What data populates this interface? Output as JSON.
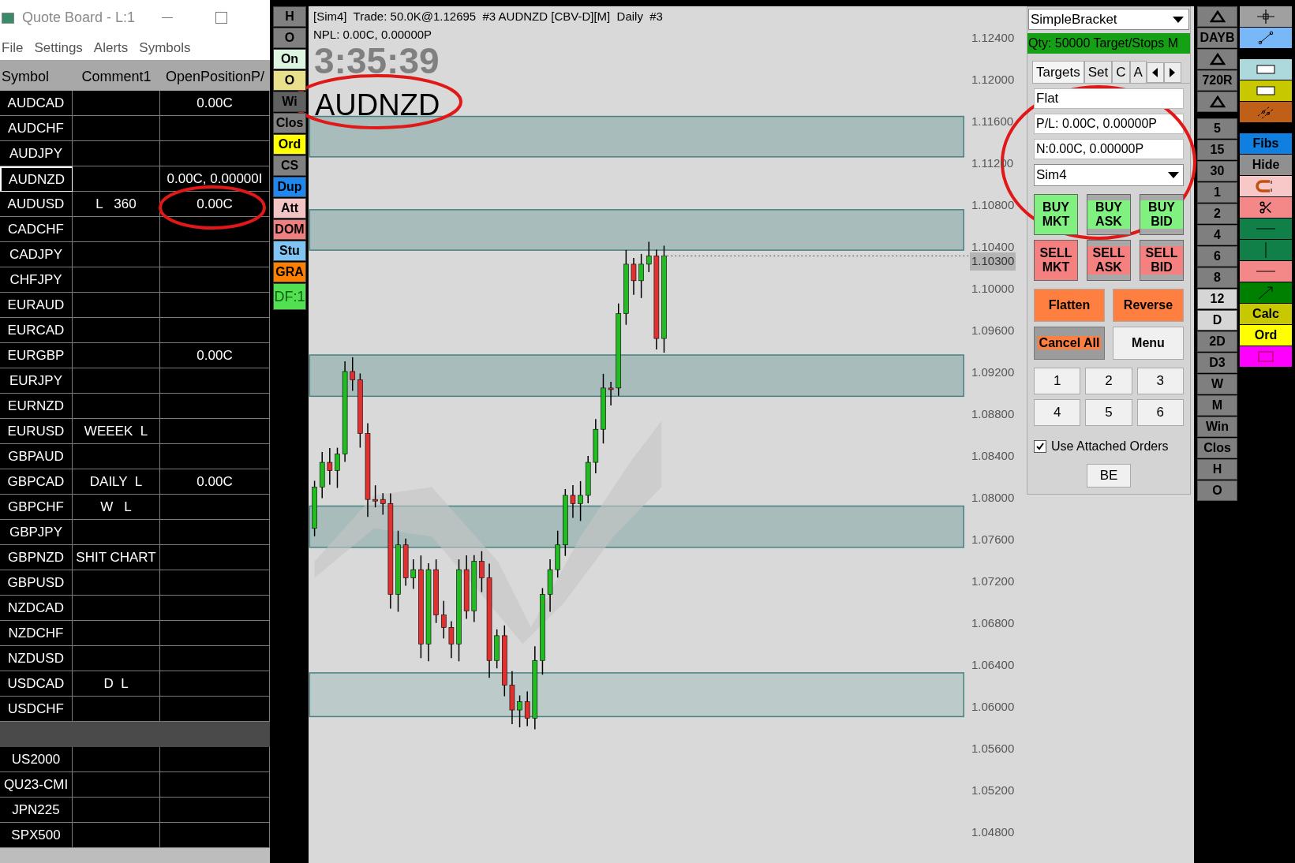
{
  "quote_board": {
    "title": "Quote Board - L:1",
    "menu": [
      "File",
      "Settings",
      "Alerts",
      "Symbols"
    ],
    "columns": [
      "Symbol",
      "Comment1",
      "OpenPositionP/"
    ],
    "rows": [
      {
        "kind": "row",
        "cells": [
          "AUDCAD",
          "",
          "0.00C"
        ],
        "selected": false
      },
      {
        "kind": "row",
        "cells": [
          "AUDCHF",
          "",
          ""
        ],
        "selected": false
      },
      {
        "kind": "row",
        "cells": [
          "AUDJPY",
          "",
          ""
        ],
        "selected": false
      },
      {
        "kind": "row",
        "cells": [
          "AUDNZD",
          "",
          "0.00C, 0.00000I"
        ],
        "selected": true
      },
      {
        "kind": "row",
        "cells": [
          "AUDUSD",
          "L   360",
          "0.00C"
        ],
        "selected": false
      },
      {
        "kind": "row",
        "cells": [
          "CADCHF",
          "",
          ""
        ],
        "selected": false
      },
      {
        "kind": "row",
        "cells": [
          "CADJPY",
          "",
          ""
        ],
        "selected": false
      },
      {
        "kind": "row",
        "cells": [
          "CHFJPY",
          "",
          ""
        ],
        "selected": false
      },
      {
        "kind": "row",
        "cells": [
          "EURAUD",
          "",
          ""
        ],
        "selected": false
      },
      {
        "kind": "row",
        "cells": [
          "EURCAD",
          "",
          ""
        ],
        "selected": false
      },
      {
        "kind": "row",
        "cells": [
          "EURGBP",
          "",
          "0.00C"
        ],
        "selected": false
      },
      {
        "kind": "row",
        "cells": [
          "EURJPY",
          "",
          ""
        ],
        "selected": false
      },
      {
        "kind": "row",
        "cells": [
          "EURNZD",
          "",
          ""
        ],
        "selected": false
      },
      {
        "kind": "row",
        "cells": [
          "EURUSD",
          "WEEEK  L",
          ""
        ],
        "selected": false
      },
      {
        "kind": "row",
        "cells": [
          "GBPAUD",
          "",
          ""
        ],
        "selected": false
      },
      {
        "kind": "row",
        "cells": [
          "GBPCAD",
          "DAILY  L",
          "0.00C"
        ],
        "selected": false
      },
      {
        "kind": "row",
        "cells": [
          "GBPCHF",
          "W   L",
          ""
        ],
        "selected": false
      },
      {
        "kind": "row",
        "cells": [
          "GBPJPY",
          "",
          ""
        ],
        "selected": false
      },
      {
        "kind": "row",
        "cells": [
          "GBPNZD",
          "SHIT CHART",
          ""
        ],
        "selected": false
      },
      {
        "kind": "row",
        "cells": [
          "GBPUSD",
          "",
          ""
        ],
        "selected": false
      },
      {
        "kind": "row",
        "cells": [
          "NZDCAD",
          "",
          ""
        ],
        "selected": false
      },
      {
        "kind": "row",
        "cells": [
          "NZDCHF",
          "",
          ""
        ],
        "selected": false
      },
      {
        "kind": "row",
        "cells": [
          "NZDUSD",
          "",
          ""
        ],
        "selected": false
      },
      {
        "kind": "row",
        "cells": [
          "USDCAD",
          "D  L",
          ""
        ],
        "selected": false
      },
      {
        "kind": "row",
        "cells": [
          "USDCHF",
          "",
          ""
        ],
        "selected": false
      },
      {
        "kind": "separator"
      },
      {
        "kind": "row",
        "cells": [
          "US2000",
          "",
          ""
        ],
        "selected": false
      },
      {
        "kind": "row",
        "cells": [
          "QU23-CMI",
          "",
          ""
        ],
        "selected": false
      },
      {
        "kind": "row",
        "cells": [
          "JPN225",
          "",
          ""
        ],
        "selected": false
      },
      {
        "kind": "row",
        "cells": [
          "SPX500",
          "",
          ""
        ],
        "selected": false
      }
    ]
  },
  "left_buttons": [
    {
      "label": "H",
      "color": "#808080"
    },
    {
      "label": "O",
      "color": "#808080"
    },
    {
      "label": "On",
      "color": "#dcf5e0"
    },
    {
      "label": "O",
      "color": "#e8e08a"
    },
    {
      "label": "Wi",
      "color": "#606060"
    },
    {
      "label": "Clos",
      "color": "#808080"
    },
    {
      "label": "Ord",
      "color": "#ffff00"
    },
    {
      "label": "CS",
      "color": "#808080"
    },
    {
      "label": "Dup",
      "color": "#1e88f0"
    },
    {
      "label": "Att",
      "color": "#f2c4c4"
    },
    {
      "label": "DOM",
      "color": "#f08080"
    },
    {
      "label": "Stu",
      "color": "#80c4f4"
    },
    {
      "label": "GRA",
      "color": "#ff7f00"
    },
    {
      "label": "DF:1",
      "color": "#50e050"
    }
  ],
  "chart": {
    "header": "[Sim4]  Trade: 50.0K@1.12695  #3 AUDNZD [CBV-D][M]  Daily  #3",
    "npl": "NPL: 0.00C, 0.00000P",
    "timer": "3:35:39",
    "symbol": "AUDNZD",
    "price_axis": [
      "1.12400",
      "1.12000",
      "1.11600",
      "1.11200",
      "1.10800",
      "1.10400",
      "1.10000",
      "1.09600",
      "1.09200",
      "1.08800",
      "1.08400",
      "1.08000",
      "1.07600",
      "1.07200",
      "1.06800",
      "1.06400",
      "1.06000",
      "1.05600",
      "1.05200",
      "1.04800"
    ],
    "current_price": "1.10300"
  },
  "order_panel": {
    "strategy": "SimpleBracket",
    "qty_bar": "Qty: 50000 Target/Stops M",
    "tabs": [
      {
        "label": "Targets",
        "selected": true
      },
      {
        "label": "Set",
        "selected": false
      },
      {
        "label": "C",
        "selected": false
      },
      {
        "label": "A",
        "selected": false
      }
    ],
    "status": "Flat",
    "pl": "P/L: 0.00C, 0.00000P",
    "net": "N:0.00C, 0.00000P",
    "account": "Sim4",
    "buy_buttons": [
      {
        "label": "BUY MKT",
        "kind": "market"
      },
      {
        "label": "BUY ASK",
        "kind": "limit"
      },
      {
        "label": "BUY BID",
        "kind": "limit"
      }
    ],
    "sell_buttons": [
      {
        "label": "SELL MKT",
        "kind": "market"
      },
      {
        "label": "SELL ASK",
        "kind": "limit"
      },
      {
        "label": "SELL BID",
        "kind": "limit"
      }
    ],
    "flatten": "Flatten",
    "reverse": "Reverse",
    "cancel_all": "Cancel All",
    "menu": "Menu",
    "number_buttons": [
      "1",
      "2",
      "3",
      "4",
      "5",
      "6"
    ],
    "use_attached_orders": {
      "label": "Use Attached Orders",
      "checked": true
    },
    "be": "BE"
  },
  "timeframe_groups": [
    [
      {
        "kind": "triangle",
        "selected": false
      },
      {
        "kind": "text",
        "label": "DAYB",
        "selected": false
      },
      {
        "kind": "triangle",
        "selected": false
      },
      {
        "kind": "text",
        "label": "720R",
        "selected": false
      },
      {
        "kind": "triangle",
        "selected": false
      }
    ],
    [
      {
        "kind": "text",
        "label": "5",
        "selected": false
      },
      {
        "kind": "text",
        "label": "15",
        "selected": false
      },
      {
        "kind": "text",
        "label": "30",
        "selected": false
      },
      {
        "kind": "text",
        "label": "1",
        "selected": false
      },
      {
        "kind": "text",
        "label": "2",
        "selected": false
      },
      {
        "kind": "text",
        "label": "4",
        "selected": false
      },
      {
        "kind": "text",
        "label": "6",
        "selected": false
      },
      {
        "kind": "text",
        "label": "8",
        "selected": false
      },
      {
        "kind": "text",
        "label": "12",
        "selected": true
      },
      {
        "kind": "text",
        "label": "D",
        "selected": true
      },
      {
        "kind": "text",
        "label": "2D",
        "selected": false
      },
      {
        "kind": "text",
        "label": "D3",
        "selected": false
      },
      {
        "kind": "text",
        "label": "W",
        "selected": false
      },
      {
        "kind": "text",
        "label": "M",
        "selected": false
      },
      {
        "kind": "text",
        "label": "Win",
        "selected": false
      },
      {
        "kind": "text",
        "label": "Clos",
        "selected": false
      },
      {
        "kind": "text",
        "label": "H",
        "selected": false
      },
      {
        "kind": "text",
        "label": "O",
        "selected": false
      }
    ]
  ],
  "tool_groups": [
    [
      {
        "kind": "crosshair",
        "color": "#a0a0a0"
      },
      {
        "kind": "segment",
        "color": "#78b8f8"
      }
    ],
    [
      {
        "kind": "rectangle",
        "color": "#add8dc"
      },
      {
        "kind": "rectangle",
        "color": "#c8c800"
      },
      {
        "kind": "channel",
        "color": "#c06018"
      }
    ],
    [
      {
        "kind": "text",
        "label": "Fibs",
        "color": "#1080e0"
      },
      {
        "kind": "text",
        "label": "Hide",
        "color": "#909090"
      },
      {
        "kind": "magnet",
        "color": "#f8c8c8"
      },
      {
        "kind": "scissors",
        "color": "#f48888"
      },
      {
        "kind": "hline",
        "color": "#108048"
      },
      {
        "kind": "vline",
        "color": "#108048"
      },
      {
        "kind": "hline",
        "color": "#f48888"
      },
      {
        "kind": "arrow",
        "color": "#008000"
      },
      {
        "kind": "text",
        "label": "Calc",
        "color": "#c8c800"
      },
      {
        "kind": "text",
        "label": "Ord",
        "color": "#ffff00"
      },
      {
        "kind": "box",
        "color": "#ff00ff"
      }
    ]
  ]
}
